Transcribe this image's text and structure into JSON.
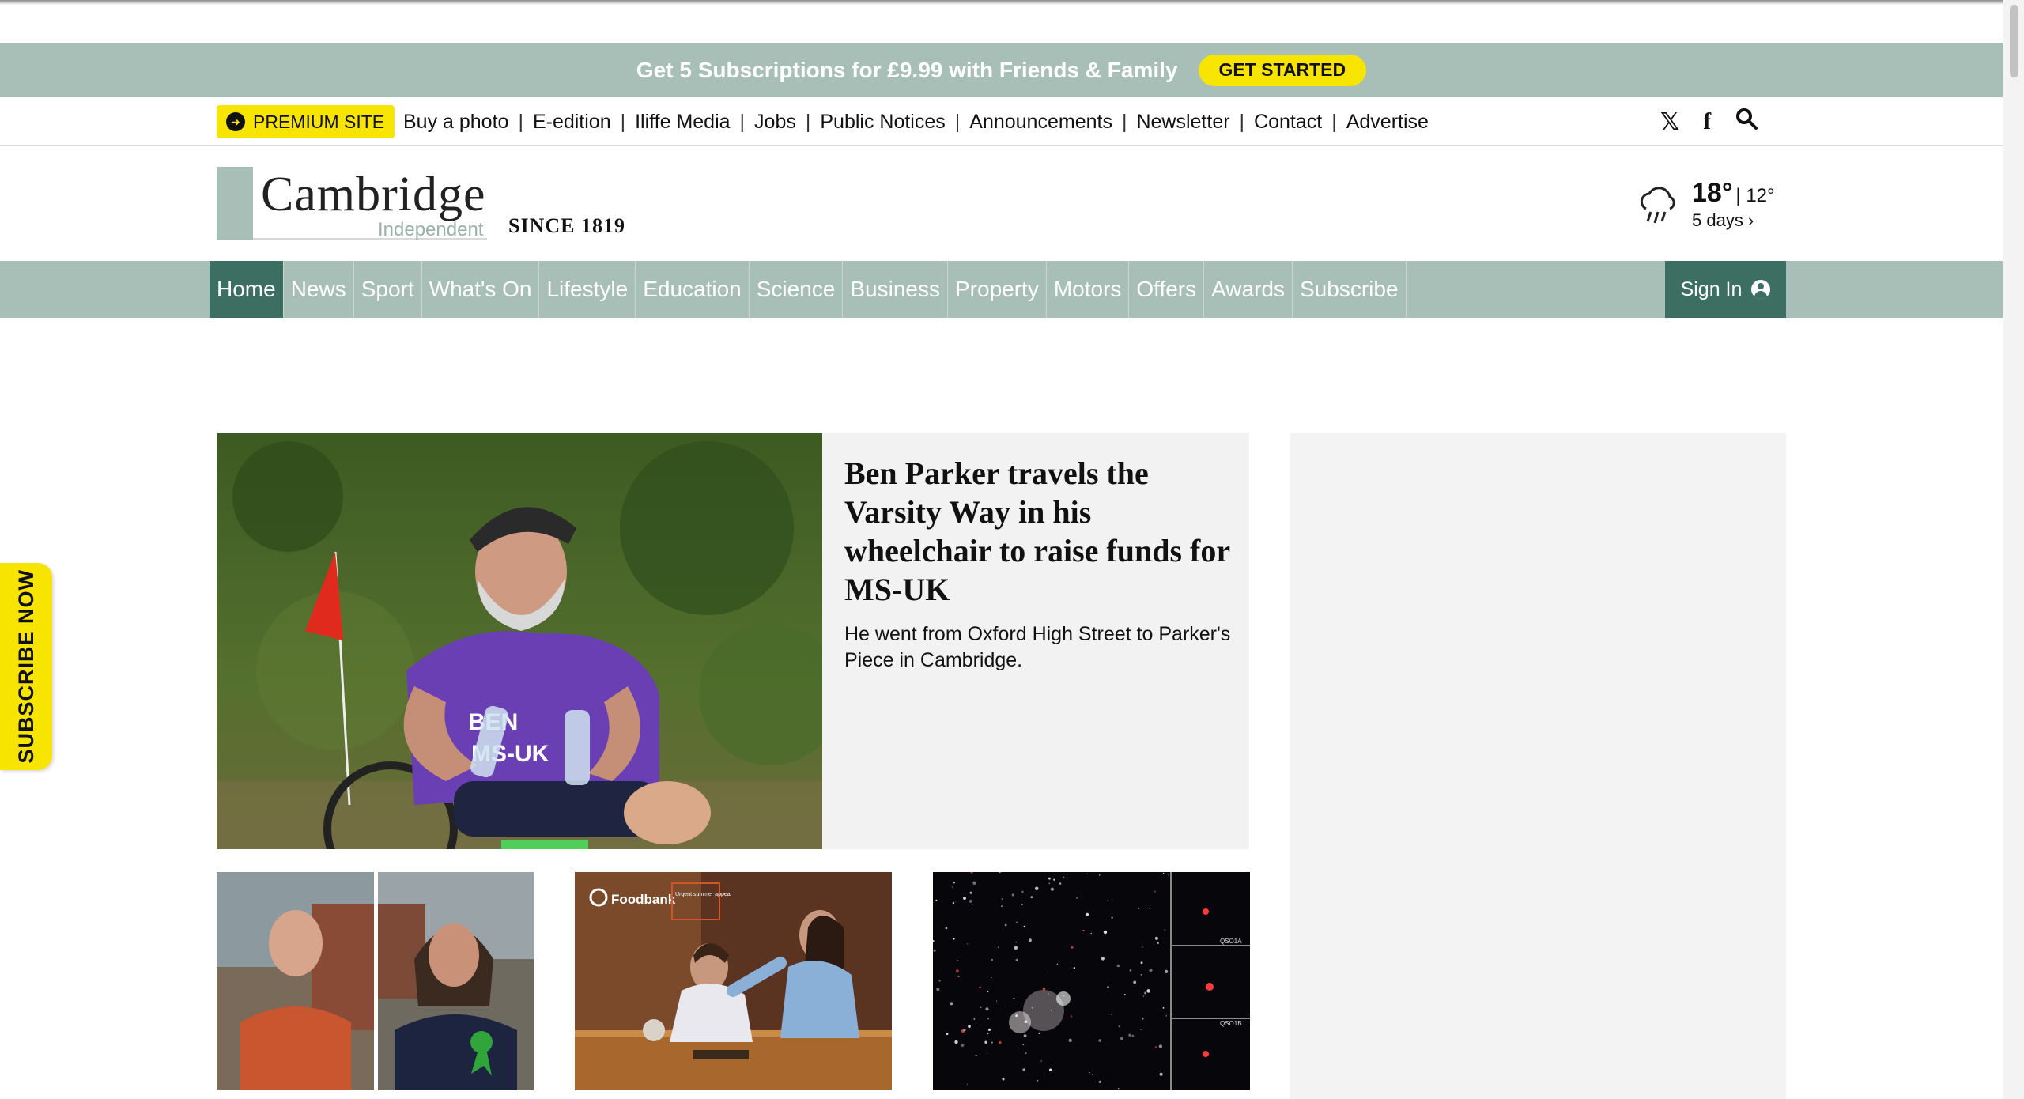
{
  "promo": {
    "text": "Get 5 Subscriptions for £9.99 with Friends & Family",
    "button": "GET STARTED"
  },
  "utility": {
    "premium_label": "PREMIUM SITE",
    "links": [
      "Buy a photo",
      "E-edition",
      "Iliffe Media",
      "Jobs",
      "Public Notices",
      "Announcements",
      "Newsletter",
      "Contact",
      "Advertise"
    ],
    "separator": "|",
    "icons": [
      "x-icon",
      "facebook-icon",
      "search-icon"
    ]
  },
  "masthead": {
    "logo_main": "Cambridge",
    "logo_sub": "Independent",
    "since": "SINCE 1819"
  },
  "weather": {
    "high": "18°",
    "low": "| 12°",
    "days": "5 days ›",
    "icon": "rain-cloud-icon"
  },
  "nav": {
    "items": [
      "Home",
      "News",
      "Sport",
      "What's On",
      "Lifestyle",
      "Education",
      "Science",
      "Business",
      "Property",
      "Motors",
      "Offers",
      "Awards",
      "Subscribe"
    ],
    "active": "Home",
    "signin": "Sign In"
  },
  "subscribe_tab": "SUBSCRIBE NOW",
  "lead": {
    "title": "Ben Parker travels the Varsity Way in his wheelchair to raise funds for MS-UK",
    "summary": "He went from Oxford High Street to Parker's Piece in Cambridge.",
    "shirt_text": [
      "BEN",
      "MS-UK"
    ]
  },
  "thumb_labels": {
    "foodbank_brand": "Foodbank",
    "foodbank_appeal": "Urgent summer appeal",
    "space_tags": [
      "QSO1A",
      "QSO1B"
    ]
  },
  "colors": {
    "sage": "#a7bfb6",
    "dark_green": "#3d6e62",
    "yellow": "#f7e400"
  }
}
